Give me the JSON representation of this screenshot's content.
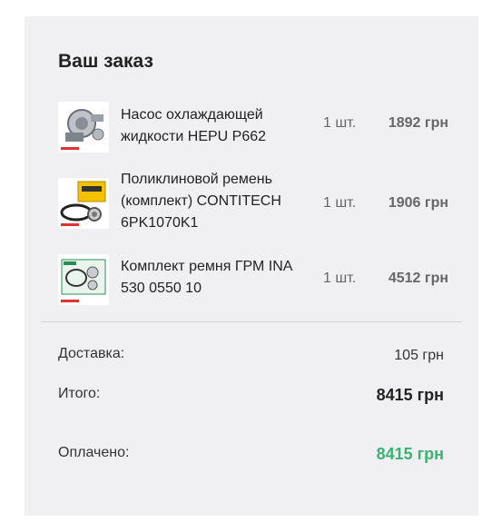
{
  "order": {
    "title": "Ваш заказ",
    "items": [
      {
        "icon": "water-pump-image",
        "name": "Насос охлаждающей жидкости HEPU P662",
        "qty": "1 шт.",
        "price": "1892 грн"
      },
      {
        "icon": "timing-belt-kit-image",
        "name": "Поликлиновой ремень (комплект) CONTITECH 6PK1070K1",
        "qty": "1 шт.",
        "price": "1906 грн"
      },
      {
        "icon": "belt-kit-image",
        "name": "Комплект ремня ГРМ INA 530 0550 10",
        "qty": "1 шт.",
        "price": "4512 грн"
      }
    ]
  },
  "summary": {
    "delivery_label": "Доставка:",
    "delivery_value": "105 грн",
    "total_label": "Итого:",
    "total_value": "8415 грн",
    "paid_label": "Оплачено:",
    "paid_value": "8415 грн"
  },
  "colors": {
    "panel_bg": "#f0f0f2",
    "paid_green": "#3bb273"
  }
}
